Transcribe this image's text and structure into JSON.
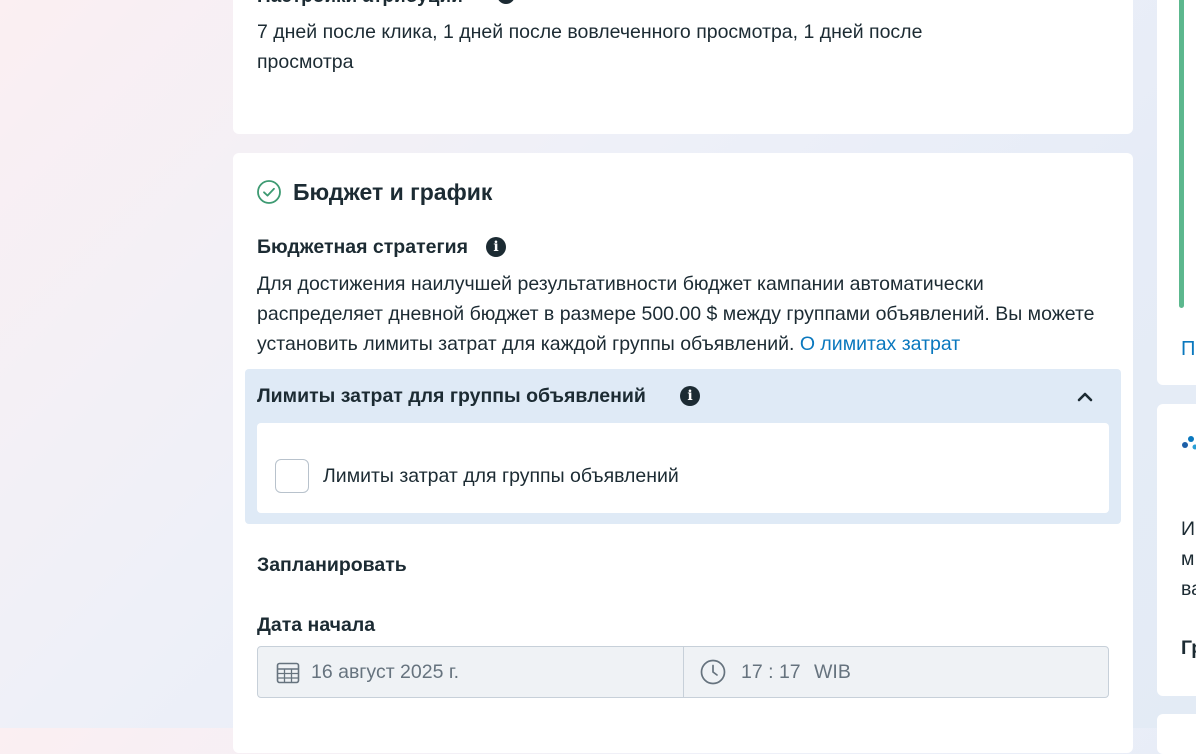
{
  "attribution": {
    "title": "Настройки атрибуции",
    "text": "7 дней после клика, 1 дней после вовлеченного просмотра, 1 дней после просмотра"
  },
  "budget_section": {
    "title": "Бюджет и график",
    "strategy_label": "Бюджетная стратегия",
    "strategy_text": "Для достижения наилучшей результативности бюджет кампании автоматически распределяет дневной бюджет в размере 500.00 $ между группами объявлений. Вы можете установить лимиты затрат для каждой группы объявлений.",
    "strategy_link": "О лимитах затрат",
    "limits_panel": {
      "title": "Лимиты затрат для группы объявлений",
      "checkbox_label": "Лимиты затрат для группы объявлений",
      "checked": false
    },
    "schedule_label": "Запланировать",
    "start_date_label": "Дата начала",
    "start_date_value": "16 август 2025 г.",
    "start_time_value": "17 : 17",
    "timezone": "WIB"
  },
  "right_panel": {
    "link_partial": "П",
    "text_line1": "И",
    "text_line2": "м",
    "text_line3": "ва",
    "bold_partial": "Гр"
  },
  "colors": {
    "accent_link": "#0a78be",
    "success_green": "#3d9a72",
    "panel_blue": "#dfeaf6"
  },
  "icons": {
    "section_status": "check-circle-icon",
    "info": "info-icon",
    "collapse": "chevron-up-icon",
    "date": "calendar-icon",
    "time": "clock-icon"
  }
}
